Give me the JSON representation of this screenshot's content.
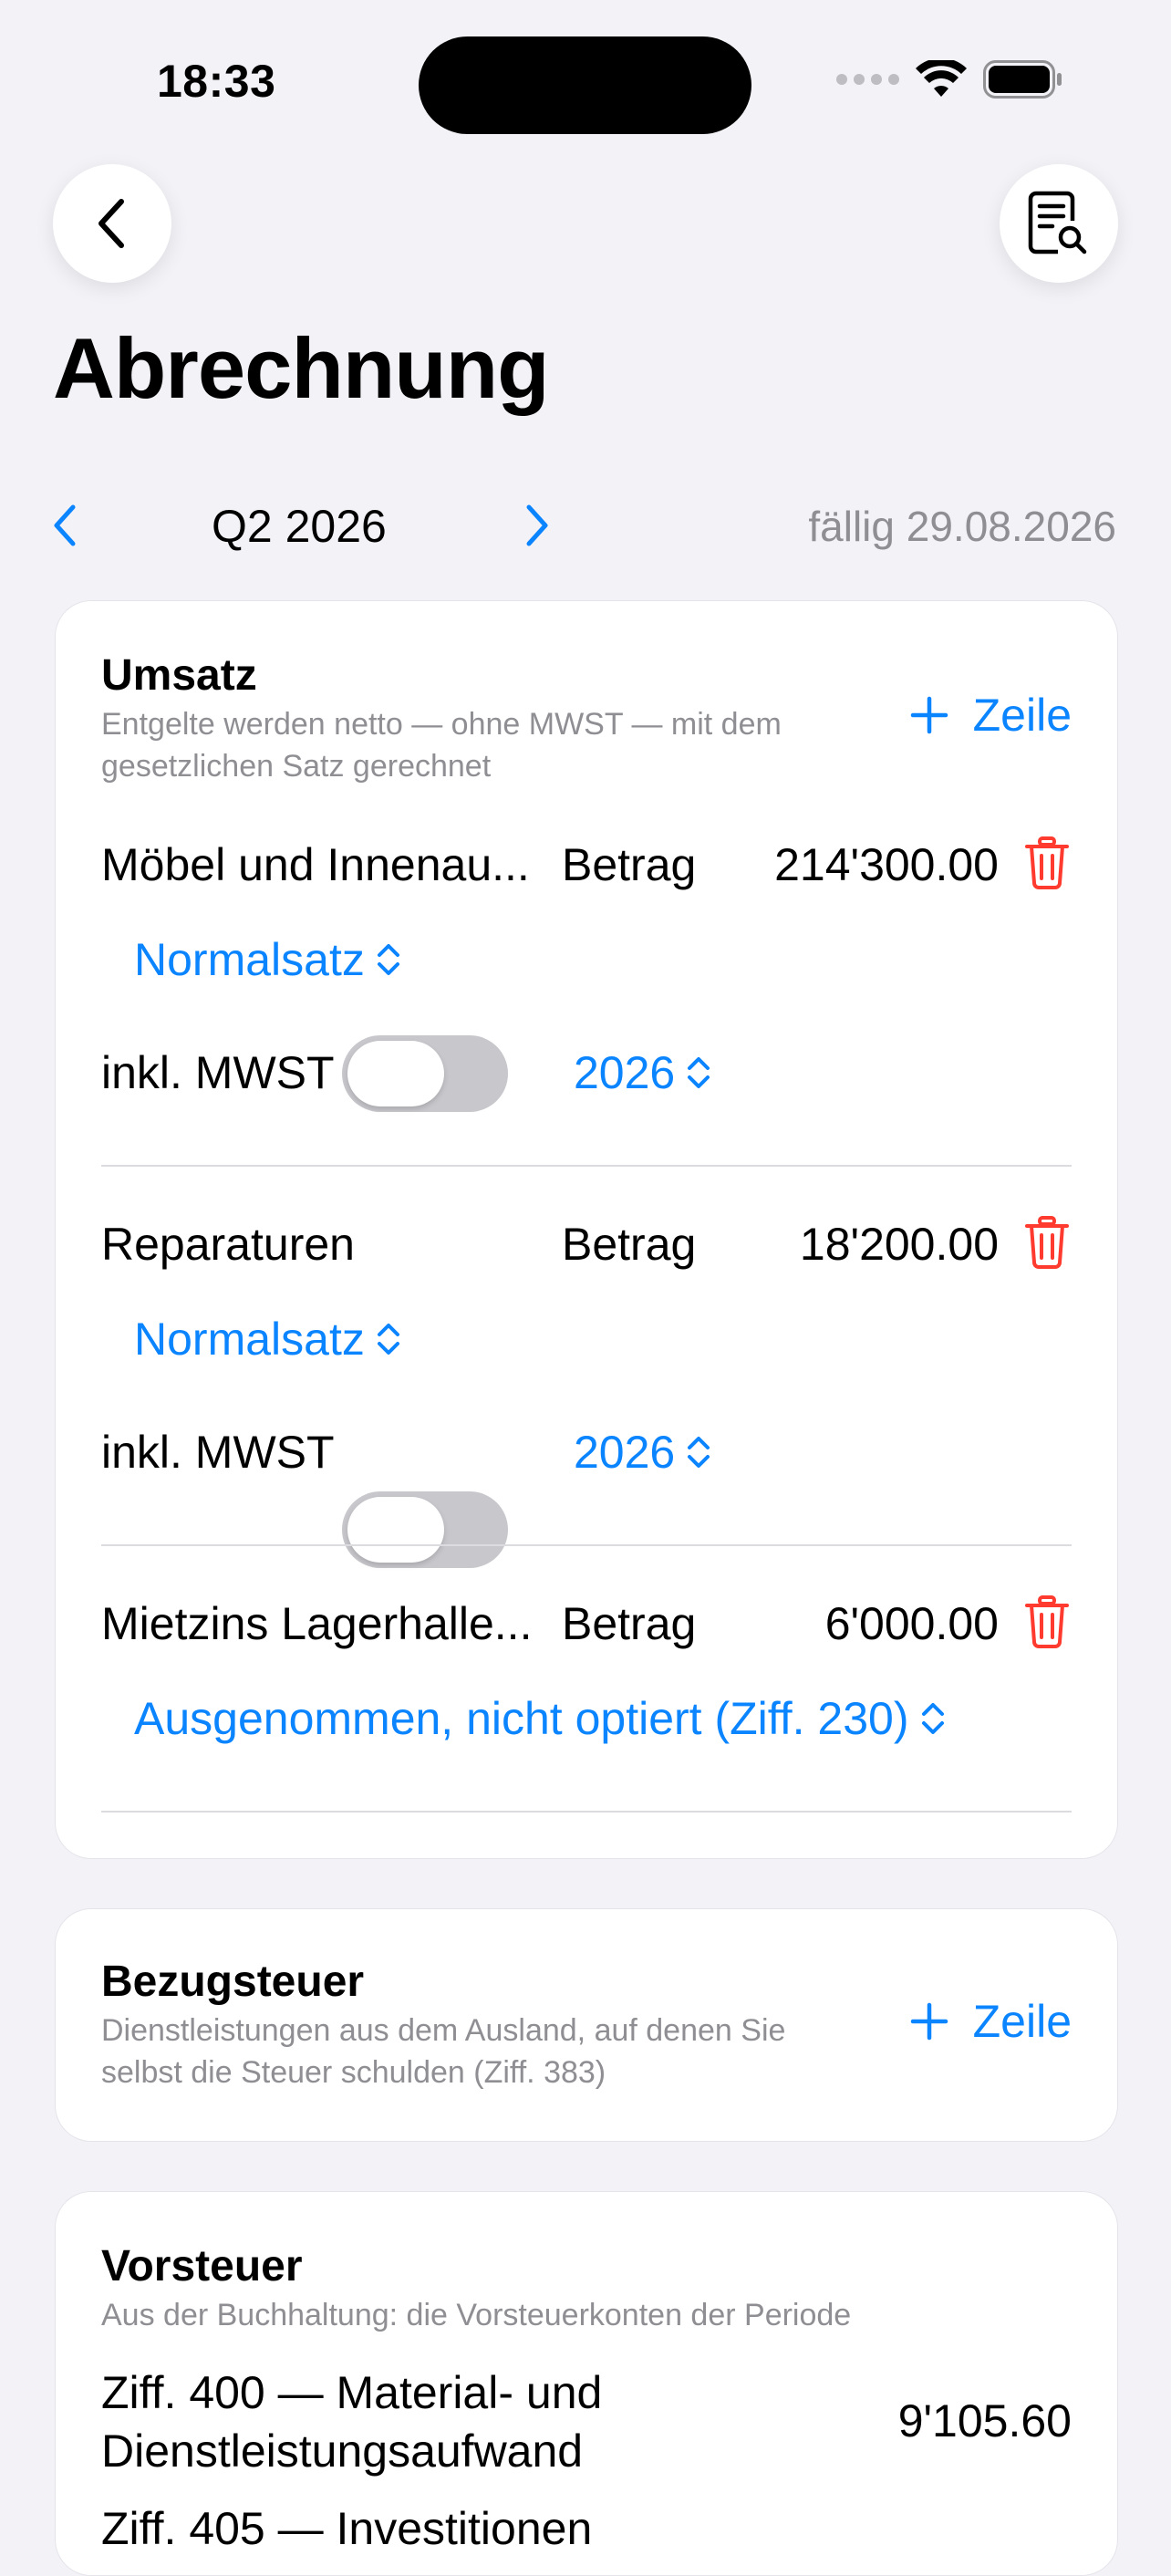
{
  "status_bar": {
    "time": "18:33"
  },
  "nav": {
    "back_icon": "chevron-left-icon",
    "doc_icon": "document-search-icon"
  },
  "page": {
    "title": "Abrechnung"
  },
  "period": {
    "label": "Q2 2026",
    "due": "fällig 29.08.2026"
  },
  "umsatz": {
    "title": "Umsatz",
    "subtitle_line1": "Entgelte werden netto — ohne MWST — mit dem",
    "subtitle_line2": "gesetzlichen Satz gerechnet",
    "add_label": "Zeile",
    "rows": [
      {
        "name": "Möbel und Innenau...",
        "betrag_label": "Betrag",
        "amount": "214'300.00",
        "rate": "Normalsatz",
        "incl_label": "inkl. MWST",
        "incl_on": false,
        "year": "2026"
      },
      {
        "name": "Reparaturen",
        "betrag_label": "Betrag",
        "amount": "18'200.00",
        "rate": "Normalsatz",
        "incl_label": "inkl. MWST",
        "incl_on": false,
        "year": "2026"
      },
      {
        "name": "Mietzins Lagerhalle...",
        "betrag_label": "Betrag",
        "amount": "6'000.00",
        "rate": "Ausgenommen, nicht optiert (Ziff. 230)"
      }
    ]
  },
  "bezugsteuer": {
    "title": "Bezugsteuer",
    "subtitle_line1": "Dienstleistungen aus dem Ausland, auf denen Sie",
    "subtitle_line2": "selbst die Steuer schulden (Ziff. 383)",
    "add_label": "Zeile"
  },
  "vorsteuer": {
    "title": "Vorsteuer",
    "subtitle": "Aus der Buchhaltung: die Vorsteuerkonten der Periode",
    "rows": [
      {
        "line1": "Ziff. 400 — Material- und",
        "line2": "Dienstleistungsaufwand",
        "amount": "9'105.60"
      },
      {
        "line1": "Ziff. 405 — Investitionen"
      }
    ]
  },
  "colors": {
    "accent": "#0a84ff",
    "danger": "#ff3b30",
    "background": "#f2f2f7"
  }
}
